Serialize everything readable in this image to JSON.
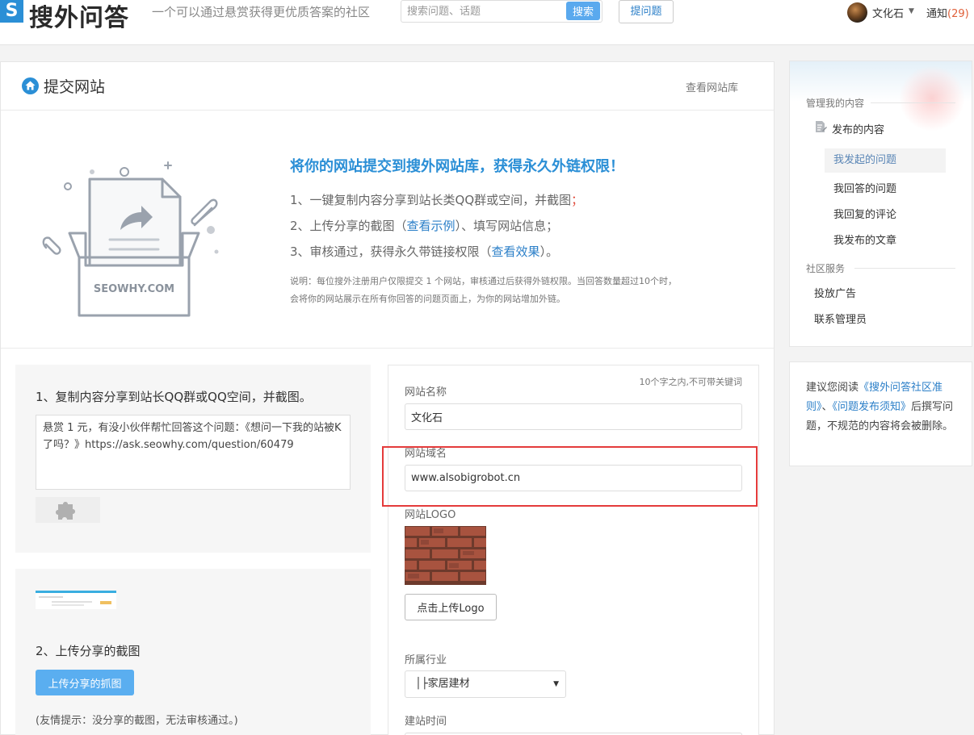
{
  "header": {
    "logo_mark": "S",
    "logo_text": "搜外问答",
    "slogan": "一个可以通过悬赏获得更优质答案的社区",
    "search_placeholder": "搜索问题、话题",
    "search_button": "搜索",
    "ask_button": "提问题",
    "user_name": "文化石",
    "notify_label": "通知",
    "notify_count": "(29)"
  },
  "page": {
    "title": "提交网站",
    "view_library": "查看网站库"
  },
  "intro": {
    "headline": "将你的网站提交到搜外网站库，获得永久外链权限！",
    "step1": "1、一键复制内容分享到站长类QQ群或空间，并截图",
    "step1_end": "；",
    "step2_a": "2、上传分享的截图（",
    "step2_link": "查看示例",
    "step2_b": "）、填写网站信息；",
    "step3_a": "3、审核通过，获得永久带链接权限（",
    "step3_link": "查看效果",
    "step3_b": "）。",
    "note1": "说明：每位搜外注册用户仅限提交 1 个网站，审核通过后获得外链权限。当回答数量超过10个时，",
    "note2": "会将你的网站展示在所有你回答的问题页面上，为你的网站增加外链。",
    "illus_brand": "SEOWHY.COM"
  },
  "steps": {
    "step1_title": "1、复制内容分享到站长QQ群或QQ空间，并截图。",
    "share_text": "悬赏 1 元，有没小伙伴帮忙回答这个问题：《想问一下我的站被K了吗？》https://ask.seowhy.com/question/60479",
    "step2_title": "2、上传分享的截图",
    "upload_button": "上传分享的抓图",
    "tip": "(友情提示：没分享的截图，无法审核通过。)"
  },
  "form": {
    "name_label": "网站名称",
    "name_hint": "10个字之内,不可带关键词",
    "name_value": "文化石",
    "domain_label": "网站域名",
    "domain_value": "www.alsobigrobot.cn",
    "logo_label": "网站LOGO",
    "upload_logo_button": "点击上传Logo",
    "industry_label": "所属行业",
    "industry_value": "│├家居建材",
    "build_time_label": "建站时间"
  },
  "sidebar": {
    "manage_title": "管理我的内容",
    "published_content": "发布的内容",
    "items": [
      "我发起的问题",
      "我回答的问题",
      "我回复的评论",
      "我发布的文章"
    ],
    "community_title": "社区服务",
    "community_items": [
      "投放广告",
      "联系管理员"
    ],
    "rules_a": "建议您阅读",
    "rules_link1": "《搜外问答社区准则》",
    "rules_sep": "、",
    "rules_link2": "《问题发布须知》",
    "rules_b": "后撰写问题，不规范的内容将会被删除。"
  },
  "colors": {
    "brand_blue": "#2b8fd6",
    "link_blue": "#2b7fc8",
    "highlight_red": "#e43b3b"
  }
}
